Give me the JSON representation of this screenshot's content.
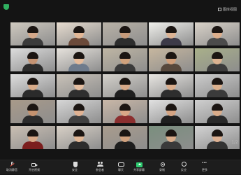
{
  "app": {
    "top_title": "",
    "view_label": "图库视图"
  },
  "page_indicator": "1/2",
  "toolbar": {
    "items": [
      {
        "label": "取消静音",
        "icon": "mic-off-icon"
      },
      {
        "label": "开启视频",
        "icon": "camera-icon"
      },
      {
        "label": "安全",
        "icon": "shield-icon"
      },
      {
        "label": "参会者",
        "icon": "participants-icon"
      },
      {
        "label": "聊天",
        "icon": "chat-icon"
      },
      {
        "label": "共享屏幕",
        "icon": "share-screen-icon"
      },
      {
        "label": "录制",
        "icon": "record-icon"
      },
      {
        "label": "反应",
        "icon": "reactions-icon"
      },
      {
        "label": "更多",
        "icon": "more-icon"
      }
    ],
    "leave_label": ""
  },
  "tiles": [
    {
      "name": "",
      "bg": "#cfc9bf",
      "skin": "#d4a88a",
      "shirt": "#3b3b3b"
    },
    {
      "name": "",
      "bg": "#e7dccf",
      "skin": "#e2b796",
      "shirt": "#6b4a3a"
    },
    {
      "name": "",
      "bg": "#b9b2a7",
      "skin": "#c79b7b",
      "shirt": "#2d2d2d"
    },
    {
      "name": "",
      "bg": "#f0f0ec",
      "skin": "#dcb394",
      "shirt": "#3d3a48"
    },
    {
      "name": "",
      "bg": "#d9d2c8",
      "skin": "#dcae8c",
      "shirt": "#4b4b4b"
    },
    {
      "name": "",
      "bg": "#dddddd",
      "skin": "#c49373",
      "shirt": "#2c2c2c"
    },
    {
      "name": "",
      "bg": "#e6e2dc",
      "skin": "#e4bb9b",
      "shirt": "#6e7b8c"
    },
    {
      "name": "",
      "bg": "#bfb6a4",
      "skin": "#d0a27d",
      "shirt": "#3a3a3a"
    },
    {
      "name": "",
      "bg": "#c7b79f",
      "skin": "#cf9e7a",
      "shirt": "#57483c"
    },
    {
      "name": "",
      "bg": "#a9b08a",
      "skin": "#dbb291",
      "shirt": "#3c3c3c"
    },
    {
      "name": "",
      "bg": "#dedede",
      "skin": "#d8ab89",
      "shirt": "#2b2b2b"
    },
    {
      "name": "",
      "bg": "#c9c2b8",
      "skin": "#e5bea0",
      "shirt": "#2f2f2f"
    },
    {
      "name": "",
      "bg": "#d4d1cb",
      "skin": "#d7a887",
      "shirt": "#1f1f1f"
    },
    {
      "name": "",
      "bg": "#e8e6e2",
      "skin": "#d9ad8c",
      "shirt": "#2e2e2e"
    },
    {
      "name": "",
      "bg": "#cccccc",
      "skin": "#dbb08e",
      "shirt": "#3b3b3b"
    },
    {
      "name": "",
      "bg": "#a89a8a",
      "skin": "#c4926f",
      "shirt": "#2b2b2b"
    },
    {
      "name": "",
      "bg": "#d6d6d6",
      "skin": "#e0b293",
      "shirt": "#404040"
    },
    {
      "name": "",
      "bg": "#c9b7a7",
      "skin": "#d9a787",
      "shirt": "#8c2f2f"
    },
    {
      "name": "",
      "bg": "#e1e1e1",
      "skin": "#d4a483",
      "shirt": "#1f1f1f"
    },
    {
      "name": "",
      "bg": "#cfcfcf",
      "skin": "#d9ac8a",
      "shirt": "#2a2a2a"
    },
    {
      "name": "",
      "bg": "#cabfb3",
      "skin": "#d8a988",
      "shirt": "#7b1e1e"
    },
    {
      "name": "",
      "bg": "#d8d0c6",
      "skin": "#e0b695",
      "shirt": "#2d2d2d"
    },
    {
      "name": "",
      "bg": "#a99c8d",
      "skin": "#cfa07d",
      "shirt": "#1e1e1e"
    },
    {
      "name": "",
      "bg": "#7a8f7e",
      "skin": "#d9ad8b",
      "shirt": "#3a3a3a"
    },
    {
      "name": "",
      "bg": "#d3d3d3",
      "skin": "#dcb092",
      "shirt": "#323232"
    }
  ]
}
